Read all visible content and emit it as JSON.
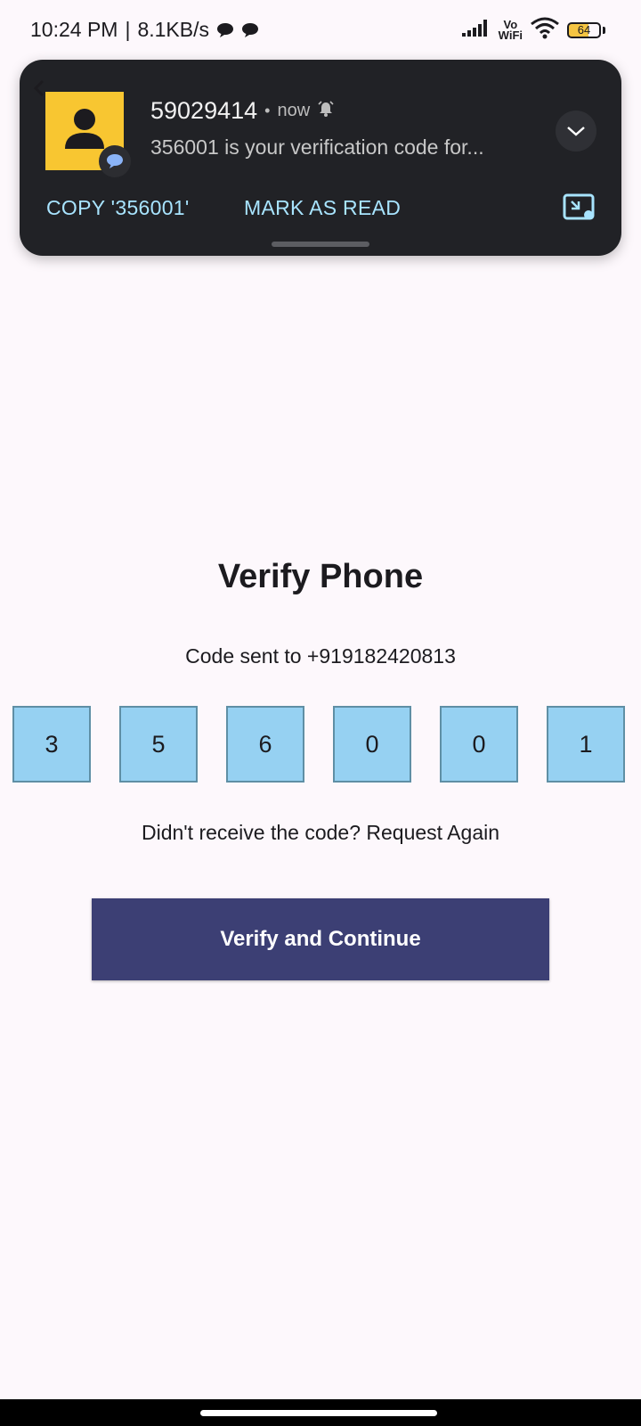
{
  "status_bar": {
    "time": "10:24 PM",
    "separator": "|",
    "speed": "8.1KB/s",
    "vowifi_top": "Vo",
    "vowifi_bottom": "WiFi",
    "battery": "64",
    "icons": [
      "chat-bubble-icon",
      "chat-bubble-icon",
      "signal-icon",
      "wifi-icon",
      "battery-icon"
    ]
  },
  "notification": {
    "sender": "59029414",
    "dot": "•",
    "time": "now",
    "message": "356001 is your verification code for...",
    "actions": {
      "copy": "COPY '356001'",
      "mark_read": "MARK AS READ"
    },
    "colors": {
      "background": "#212226",
      "avatar": "#f8c631",
      "action_text": "#a8e4ff"
    }
  },
  "main": {
    "title": "Verify Phone",
    "code_sent": "Code sent to +919182420813",
    "otp_digits": [
      "3",
      "5",
      "6",
      "0",
      "0",
      "1"
    ],
    "request_again": "Didn't receive the code? Request Again",
    "verify_button": "Verify and Continue",
    "colors": {
      "otp_box": "#96d1f2",
      "button": "#3c3f74",
      "page_background": "#fdf8fc"
    }
  }
}
